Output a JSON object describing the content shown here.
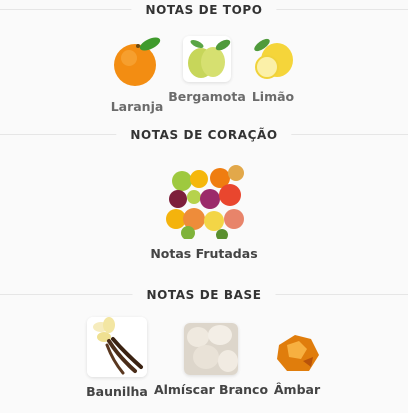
{
  "sections": {
    "top": {
      "title": "NOTAS DE TOPO",
      "notes": [
        {
          "label": "Laranja",
          "icon": "orange-icon"
        },
        {
          "label": "Bergamota",
          "icon": "bergamot-icon"
        },
        {
          "label": "Limão",
          "icon": "lemon-icon"
        }
      ]
    },
    "heart": {
      "title": "NOTAS DE CORAÇÃO",
      "notes": [
        {
          "label": "Notas Frutadas",
          "icon": "fruits-icon"
        }
      ]
    },
    "base": {
      "title": "NOTAS DE BASE",
      "notes": [
        {
          "label": "Baunilha",
          "icon": "vanilla-icon"
        },
        {
          "label": "Almíscar Branco",
          "icon": "white-musk-icon"
        },
        {
          "label": "Âmbar",
          "icon": "amber-icon"
        }
      ]
    }
  }
}
